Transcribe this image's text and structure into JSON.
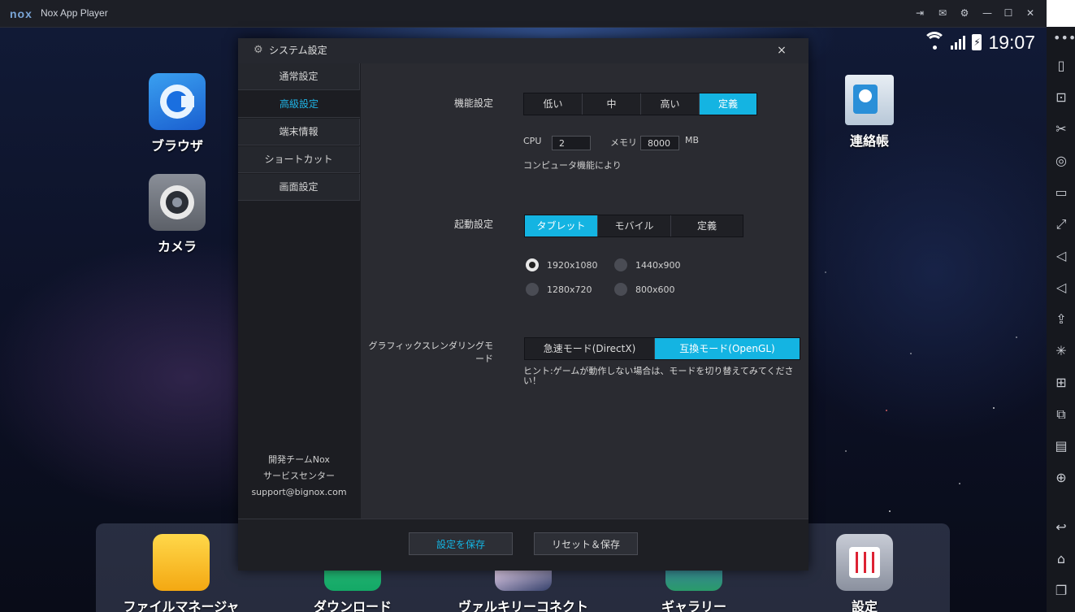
{
  "titlebar": {
    "logo": "nox",
    "title": "Nox App Player",
    "icons": [
      "pin-icon",
      "mail-icon",
      "gear-icon",
      "minimize-icon",
      "maximize-icon",
      "close-icon"
    ]
  },
  "status_bar": {
    "time": "19:07"
  },
  "desktop_apps": [
    {
      "label": "ブラウザ",
      "icon": "browser-icon"
    },
    {
      "label": "カメラ",
      "icon": "camera-icon"
    },
    {
      "label": "連絡帳",
      "icon": "contacts-icon"
    }
  ],
  "dock_apps": [
    {
      "label": "ファイルマネージャ",
      "icon": "folder-icon"
    },
    {
      "label": "ダウンロード",
      "icon": "download-icon"
    },
    {
      "label": "ヴァルキリーコネクト",
      "icon": "game-icon"
    },
    {
      "label": "ギャラリー",
      "icon": "gallery-icon"
    },
    {
      "label": "設定",
      "icon": "settings-icon"
    }
  ],
  "dialog": {
    "title": "システム設定",
    "close": "×",
    "nav": [
      "通常設定",
      "高級設定",
      "端末情報",
      "ショートカット",
      "画面設定"
    ],
    "nav_active": 1,
    "footer_info": [
      "開発チームNox",
      "サービスセンター",
      "support@bignox.com"
    ],
    "performance": {
      "label": "機能設定",
      "options": [
        "低い",
        "中",
        "高い",
        "定義"
      ],
      "selected": 3,
      "cpu_label": "CPU",
      "cpu_value": "2",
      "memory_label": "メモリ",
      "memory_value": "8000",
      "memory_unit": "MB",
      "note": "コンピュータ機能により"
    },
    "startup": {
      "label": "起動設定",
      "options": [
        "タブレット",
        "モバイル",
        "定義"
      ],
      "selected": 0,
      "resolutions": [
        "1920x1080",
        "1440x900",
        "1280x720",
        "800x600"
      ],
      "resolution_selected": 0
    },
    "graphics": {
      "label": "グラフィックスレンダリングモード",
      "options": [
        "急速モード(DirectX)",
        "互換モード(OpenGL)"
      ],
      "selected": 1,
      "hint_line1": "ヒント:ゲームが動作しない場合は、モードを切り替えてみてくださ",
      "hint_line2": "い！"
    },
    "buttons": {
      "save": "設定を保存",
      "reset_save": "リセット＆保存"
    }
  },
  "colors": {
    "accent": "#14b4e2",
    "dialog_bg": "#2a2b31",
    "titlebar_bg": "#1d1f26"
  },
  "sidebar_icons": [
    "shake-icon",
    "robot-icon",
    "scissors-icon",
    "location-icon",
    "keyboard-icon",
    "fullscreen-icon",
    "volume-up-icon",
    "volume-down-icon",
    "apk-install-icon",
    "loading-icon",
    "macro-icon",
    "multi-instance-icon",
    "toolbox-icon",
    "add-icon",
    "back-icon",
    "home-icon",
    "recent-apps-icon"
  ]
}
